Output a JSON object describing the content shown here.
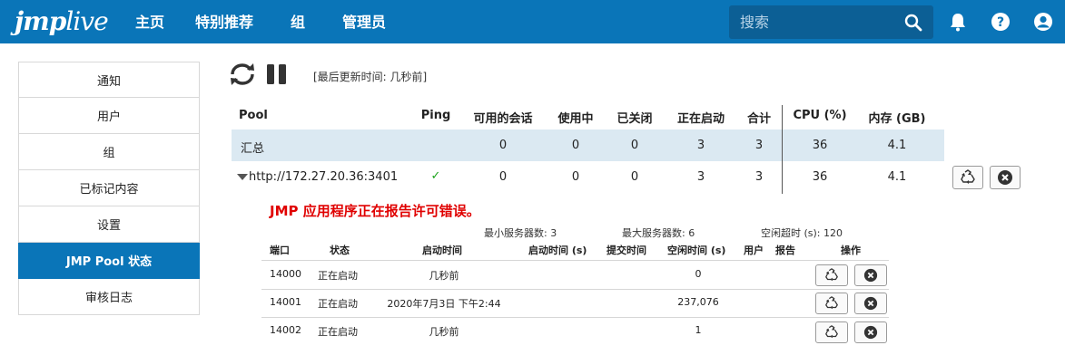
{
  "header": {
    "logo_bold": "jmp",
    "logo_light": "live",
    "nav": [
      "主页",
      "特别推荐",
      "组",
      "管理员"
    ],
    "search_placeholder": "搜索",
    "icons": [
      "search-icon",
      "bell-icon",
      "help-icon",
      "user-avatar-icon"
    ]
  },
  "sidebar": {
    "items": [
      {
        "label": "通知",
        "active": false
      },
      {
        "label": "用户",
        "active": false
      },
      {
        "label": "组",
        "active": false
      },
      {
        "label": "已标记内容",
        "active": false
      },
      {
        "label": "设置",
        "active": false
      },
      {
        "label": "JMP Pool 状态",
        "active": true
      },
      {
        "label": "审核日志",
        "active": false
      }
    ]
  },
  "main": {
    "last_updated": "[最后更新时间: 几秒前]",
    "pool_table": {
      "headers": [
        "Pool",
        "Ping",
        "可用的会话",
        "使用中",
        "已关闭",
        "正在启动",
        "合计",
        "CPU (%)",
        "内存 (GB)"
      ],
      "summary": {
        "name": "汇总",
        "available": "0",
        "in_use": "0",
        "closed": "0",
        "starting": "3",
        "total": "3",
        "cpu": "36",
        "mem": "4.1"
      },
      "pool": {
        "name": "http://172.27.20.36:3401",
        "ping": "✓",
        "available": "0",
        "in_use": "0",
        "closed": "0",
        "starting": "3",
        "total": "3",
        "cpu": "36",
        "mem": "4.1"
      }
    },
    "error_message": "JMP 应用程序正在报告许可错误。",
    "server_stats": {
      "min_servers": "最小服务器数: 3",
      "max_servers": "最大服务器数: 6",
      "idle_timeout": "空闲超时 (s): 120"
    },
    "server_table": {
      "headers": [
        "端口",
        "状态",
        "启动时间",
        "启动时间 (s)",
        "提交时间",
        "空闲时间 (s)",
        "用户",
        "报告",
        "操作"
      ],
      "rows": [
        {
          "port": "14000",
          "status": "正在启动",
          "start": "几秒前",
          "idle": "0"
        },
        {
          "port": "14001",
          "status": "正在启动",
          "start": "2020年7月3日 下午2:44",
          "idle": "237,076"
        },
        {
          "port": "14002",
          "status": "正在启动",
          "start": "几秒前",
          "idle": "1"
        }
      ]
    },
    "colors": {
      "brand": "#0a75b8",
      "error": "#e00000",
      "ok": "#1aa21a",
      "summary_bg": "#dbe9f2"
    }
  }
}
